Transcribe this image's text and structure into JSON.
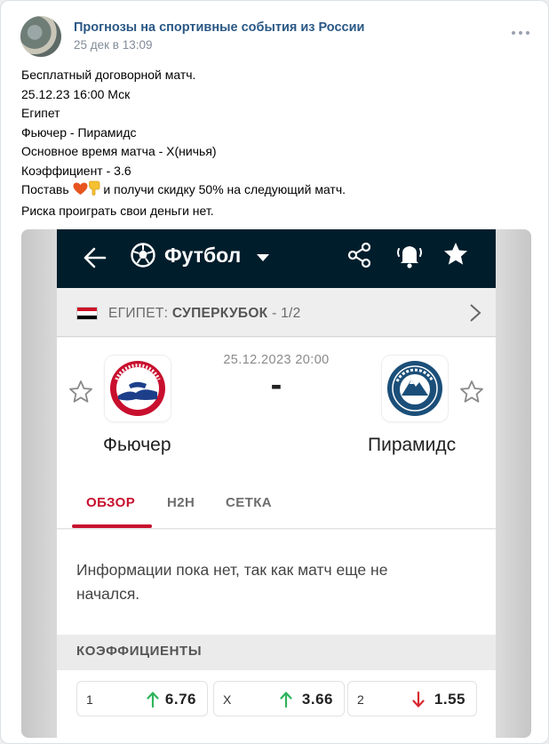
{
  "post": {
    "author": "Прогнозы на спортивные события из России",
    "date": "25 дек в 13:09",
    "lines": {
      "l1": "Бесплатный договорной матч.",
      "l2": "25.12.23 16:00 Мск",
      "l3": "Египет",
      "l4": "Фьючер - Пирамидс",
      "l5": "Основное время матча - Х(ничья)",
      "l6": "Коэффициент - 3.6",
      "l7a": "Поставь",
      "l7b": "и получи скидку 50% на следующий матч.",
      "l8": "Риска проиграть свои деньги нет."
    },
    "emoji": [
      "heart-emoji",
      "point-down-emoji"
    ]
  },
  "app": {
    "sport": "Футбол",
    "league_country": "ЕГИПЕТ:",
    "league_name": "СУПЕРКУБОК",
    "league_round": "- 1/2",
    "match_date": "25.12.2023 20:00",
    "score": "-",
    "home_team": "Фьючер",
    "away_team": "Пирамидс",
    "tabs": [
      "ОБЗОР",
      "H2H",
      "СЕТКА"
    ],
    "active_tab": "ОБЗОР",
    "info_text": "Информации пока нет, так как матч еще не начался.",
    "odds_title": "КОЭФФИЦИЕНТЫ",
    "odds": [
      {
        "label": "1",
        "value": "6.76",
        "trend": "up"
      },
      {
        "label": "X",
        "value": "3.66",
        "trend": "up"
      },
      {
        "label": "2",
        "value": "1.55",
        "trend": "down"
      }
    ],
    "colors": {
      "appbar": "#001d2b",
      "accent": "#c8102e",
      "up": "#2fb35a",
      "down": "#d8282f",
      "link": "#2a5885"
    }
  }
}
